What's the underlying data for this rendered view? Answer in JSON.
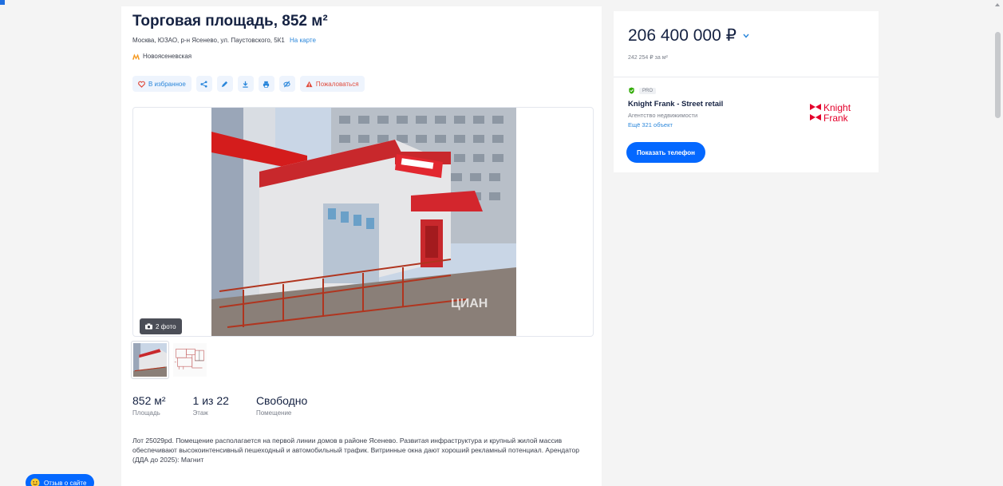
{
  "listing": {
    "title": "Торговая площадь, 852 м²",
    "address": "Москва, ЮЗАО, р-н Ясенево, ул. Паустовского, 5К1",
    "map_link": "На карте",
    "metro": "Новоясеневская"
  },
  "actions": {
    "favorite": "В избранное",
    "complain": "Пожаловаться",
    "icons": [
      "share-icon",
      "edit-icon",
      "download-icon",
      "print-icon",
      "hide-icon"
    ]
  },
  "gallery": {
    "photo_count": "2 фото",
    "watermark": "ЦИАН"
  },
  "stats": [
    {
      "value": "852 м²",
      "label": "Площадь"
    },
    {
      "value": "1 из 22",
      "label": "Этаж"
    },
    {
      "value": "Свободно",
      "label": "Помещение"
    }
  ],
  "description": "Лот 25029pd. Помещение располагается на первой линии домов в районе Ясенево. Развитая инфраструктура и крупный жилой массив обеспечивают высокоинтенсивный пешеходный и автомобильный трафик. Витринные окна дают хороший рекламный потенциал. Арендатор (ДДА до 2025): Магнит",
  "sidebar": {
    "price": "206 400 000 ₽",
    "price_per_sqm": "242 254 ₽ за м²",
    "pro_badge": "PRO",
    "agency_name": "Knight Frank - Street retail",
    "agency_type": "Агентство недвижимости",
    "agency_more": "Ещё 321 объект",
    "logo_text_1": "Knight",
    "logo_text_2": "Frank",
    "phone_button": "Показать телефон"
  },
  "feedback": {
    "label": "Отзыв о сайте"
  },
  "colors": {
    "accent": "#0468ff",
    "link": "#2b87db",
    "brand_red": "#e4002b",
    "metro_orange": "#f59a21"
  }
}
